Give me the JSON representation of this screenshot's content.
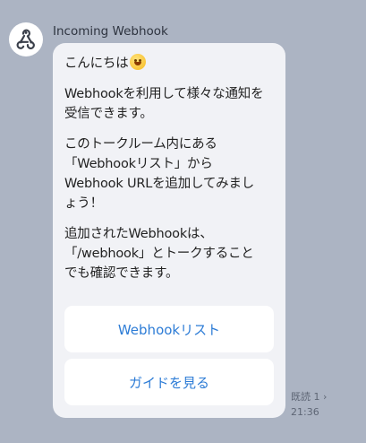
{
  "chat": {
    "sender_name": "Incoming Webhook",
    "avatar_icon": "webhook-icon",
    "message": {
      "greeting": "こんにちは",
      "greeting_emoji": "smiling-face-emoji",
      "p2": "Webhookを利用して様々な通知を\n受信できます。",
      "p3": "このトークルーム内にある\n「Webhookリスト」から\nWebhook URLを追加してみまし\nょう！",
      "p4": "追加されたWebhookは、\n「/webhook」とトークすること\nでも確認できます。"
    },
    "buttons": {
      "webhook_list": "Webhookリスト",
      "view_guide": "ガイドを見る"
    },
    "read_receipt": "既読 1 ›",
    "timestamp": "21:36"
  },
  "colors": {
    "background": "#acb4c3",
    "bubble": "#f1f2f6",
    "button_text": "#2d7cd6"
  }
}
